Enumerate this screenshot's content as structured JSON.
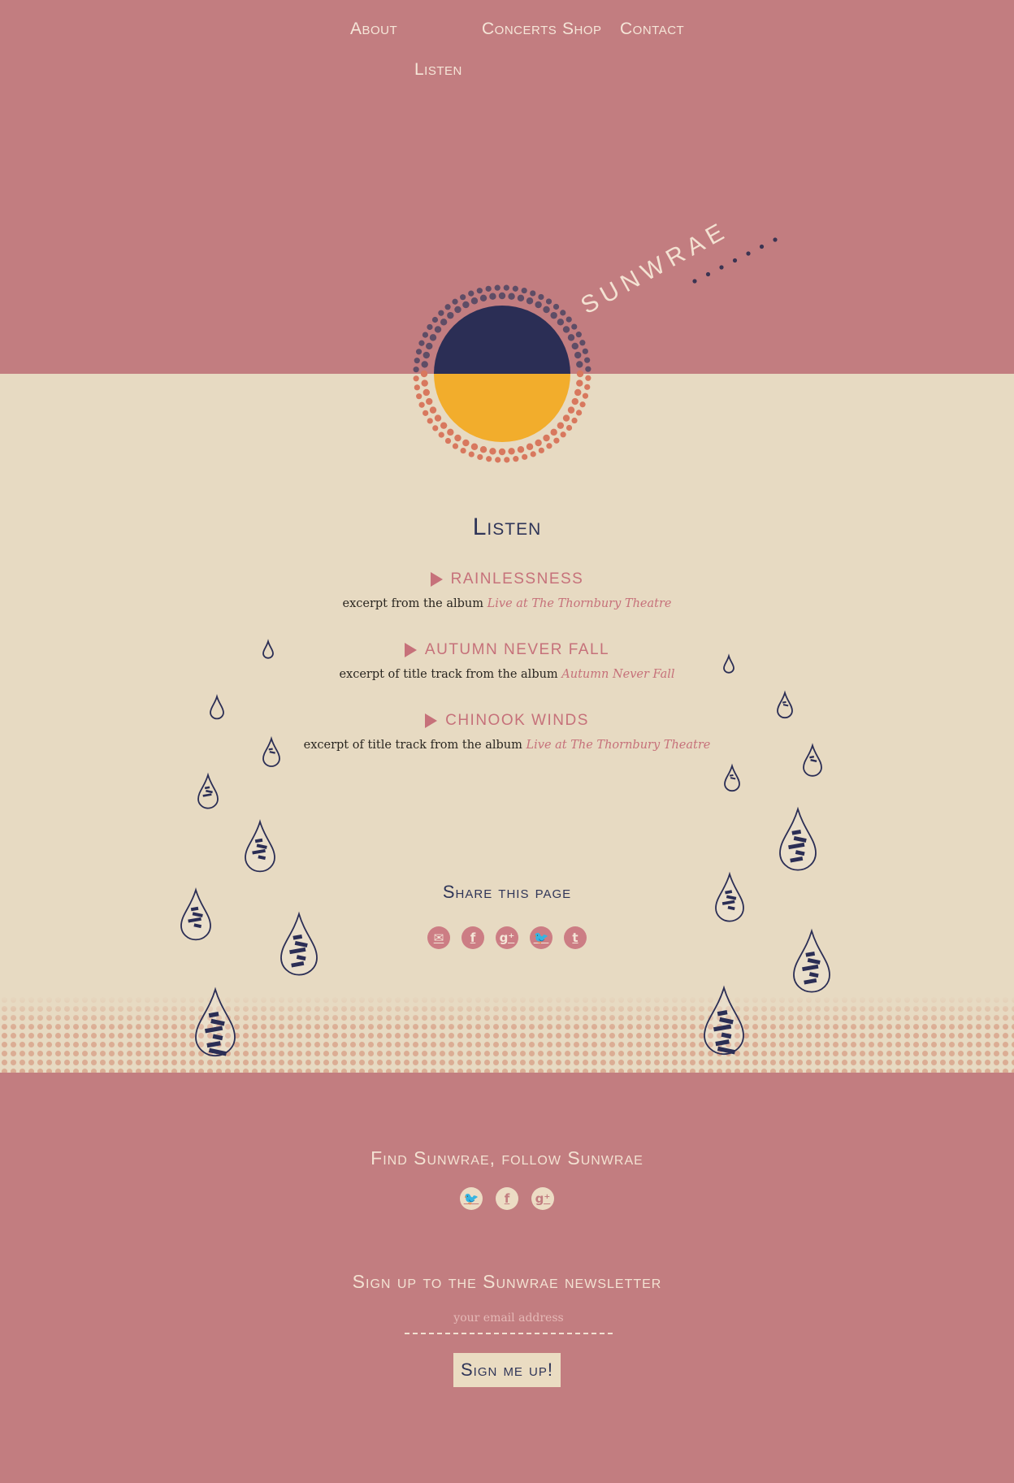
{
  "nav": {
    "about": "About",
    "listen": "Listen",
    "concerts": "Concerts",
    "shop": "Shop",
    "contact": "Contact"
  },
  "brand": {
    "name": "SUNWRAE"
  },
  "listen": {
    "title": "Listen",
    "tracks": [
      {
        "title": "Rainlessness",
        "desc": "excerpt from the album",
        "album": "Live at The Thornbury Theatre"
      },
      {
        "title": "Autumn Never Fall",
        "desc": "excerpt of title track from the album",
        "album": "Autumn Never Fall"
      },
      {
        "title": "Chinook Winds",
        "desc": "excerpt of title track from the album",
        "album": "Live at The Thornbury Theatre"
      }
    ]
  },
  "share": {
    "title": "Share this page",
    "icons": [
      "mail-icon",
      "facebook-icon",
      "google-plus-icon",
      "twitter-icon",
      "tumblr-icon"
    ],
    "glyphs": [
      "✉",
      "f",
      "g⁺",
      "🐦",
      "t"
    ]
  },
  "footer": {
    "find_title": "Find Sunwrae, follow Sunwrae",
    "follow_icons": [
      "twitter-icon",
      "facebook-icon",
      "google-plus-icon"
    ],
    "follow_glyphs": [
      "🐦",
      "f",
      "g⁺"
    ],
    "newsletter_title": "Sign up to the Sunwrae newsletter",
    "email_placeholder": "your email address",
    "signup_label": "Sign me up!"
  },
  "colors": {
    "pink": "#c27d80",
    "cream": "#e7dac2",
    "navy": "#2f3558",
    "yellow": "#f2ad2c",
    "accent_text": "#c6717a"
  }
}
